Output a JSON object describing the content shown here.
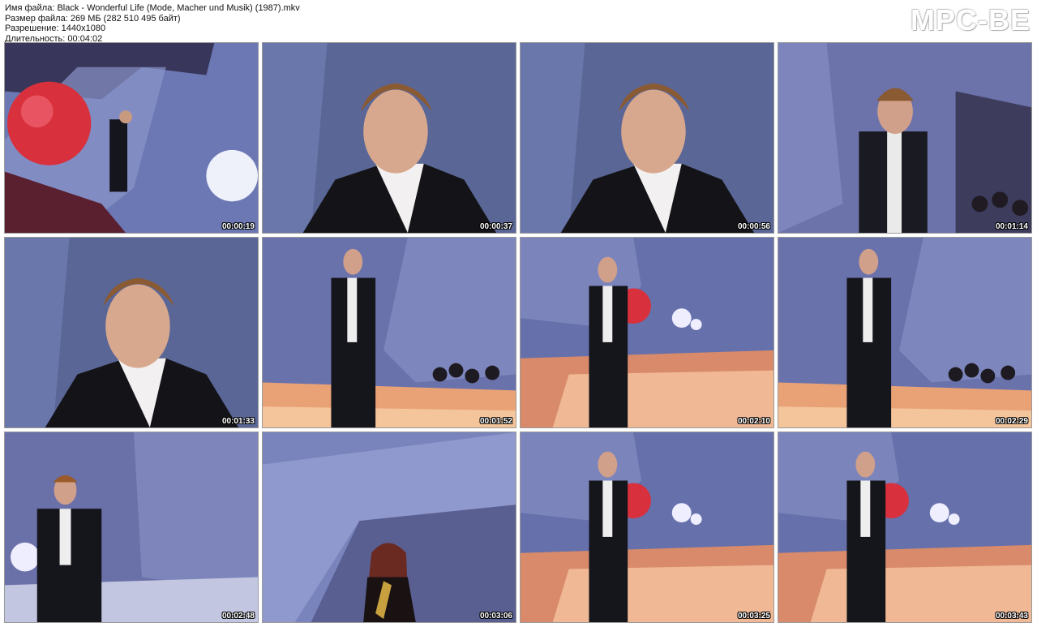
{
  "file_info": {
    "filename_line": "Имя файла: Black - Wonderful Life (Mode, Macher und Musik) (1987).mkv",
    "size_line": "Размер файла: 269 МБ (282 510 495 байт)",
    "resolution_line": "Разрешение: 1440x1080",
    "duration_line": "Длительность: 00:04:02"
  },
  "logo": "MPC-BE",
  "thumbnails": [
    {
      "timestamp": "00:00:19",
      "scene": "wide-stage-red-sphere"
    },
    {
      "timestamp": "00:00:37",
      "scene": "closeup-singer"
    },
    {
      "timestamp": "00:00:56",
      "scene": "closeup-singer"
    },
    {
      "timestamp": "00:01:14",
      "scene": "medium-singer-audience"
    },
    {
      "timestamp": "00:01:33",
      "scene": "closeup-singer"
    },
    {
      "timestamp": "00:01:52",
      "scene": "full-singer-stage"
    },
    {
      "timestamp": "00:02:10",
      "scene": "full-singer-stage-spheres"
    },
    {
      "timestamp": "00:02:29",
      "scene": "full-singer-stage"
    },
    {
      "timestamp": "00:02:48",
      "scene": "full-singer-left"
    },
    {
      "timestamp": "00:03:06",
      "scene": "saxophonist"
    },
    {
      "timestamp": "00:03:25",
      "scene": "full-singer-stage-spheres"
    },
    {
      "timestamp": "00:03:43",
      "scene": "full-singer-stage-spheres"
    }
  ]
}
